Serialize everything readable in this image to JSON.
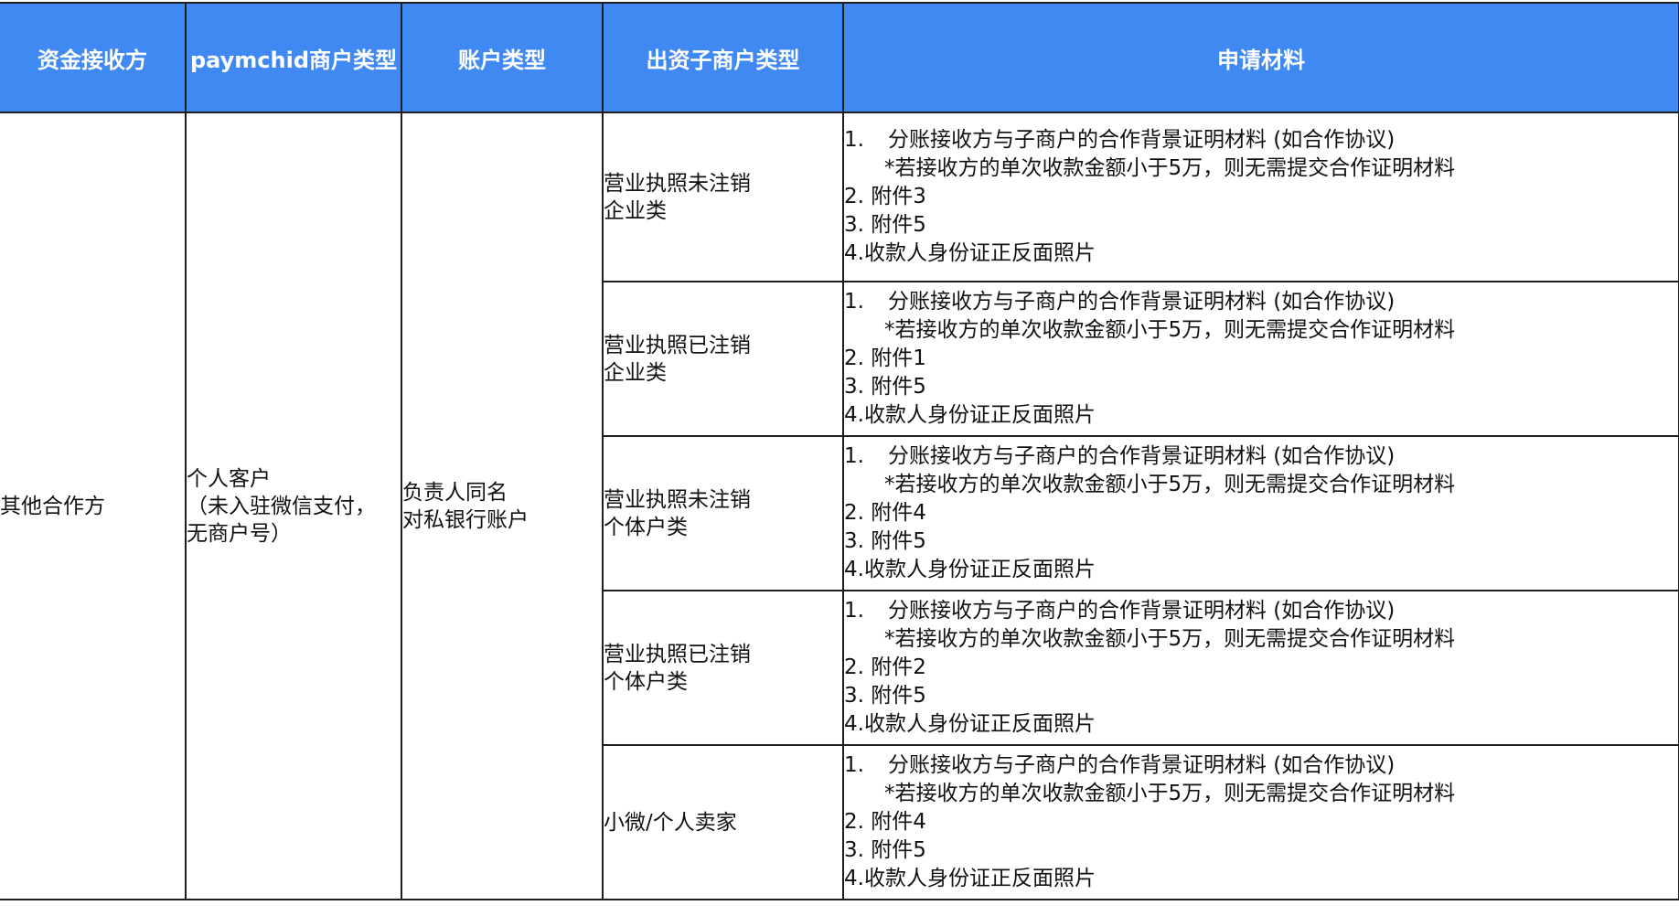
{
  "table": {
    "headers": [
      "资金接收方",
      "paymchid商户类型",
      "账户类型",
      "出资子商户类型",
      "申请材料"
    ],
    "receiver": "其他合作方",
    "merchant_type_lines": [
      "个人客户",
      "（未入驻微信支付，",
      "无商户号）"
    ],
    "account_type_lines": [
      "负责人同名",
      "对私银行账户"
    ],
    "rows": [
      {
        "sub_type_lines": [
          "营业执照未注销",
          "企业类"
        ],
        "materials": {
          "item1_num": "1.",
          "item1_text": "分账接收方与子商户的合作背景证明材料 (如合作协议)",
          "note": "*若接收方的单次收款金额小于5万，则无需提交合作证明材料",
          "item2": "2. 附件3",
          "item3": "3. 附件5",
          "item4": "4.收款人身份证正反面照片"
        }
      },
      {
        "sub_type_lines": [
          "营业执照已注销",
          "企业类"
        ],
        "materials": {
          "item1_num": "1.",
          "item1_text": "分账接收方与子商户的合作背景证明材料 (如合作协议)",
          "note": "*若接收方的单次收款金额小于5万，则无需提交合作证明材料",
          "item2": "2. 附件1",
          "item3": "3. 附件5",
          "item4": "4.收款人身份证正反面照片"
        }
      },
      {
        "sub_type_lines": [
          "营业执照未注销",
          "个体户类"
        ],
        "materials": {
          "item1_num": "1.",
          "item1_text": "分账接收方与子商户的合作背景证明材料 (如合作协议)",
          "note": "*若接收方的单次收款金额小于5万，则无需提交合作证明材料",
          "item2": "2. 附件4",
          "item3": "3. 附件5",
          "item4": "4.收款人身份证正反面照片"
        }
      },
      {
        "sub_type_lines": [
          "营业执照已注销",
          "个体户类"
        ],
        "materials": {
          "item1_num": "1.",
          "item1_text": "分账接收方与子商户的合作背景证明材料 (如合作协议)",
          "note": "*若接收方的单次收款金额小于5万，则无需提交合作证明材料",
          "item2": "2. 附件2",
          "item3": "3. 附件5",
          "item4": "4.收款人身份证正反面照片"
        }
      },
      {
        "sub_type_lines": [
          "小微/个人卖家"
        ],
        "materials": {
          "item1_num": "1.",
          "item1_text": "分账接收方与子商户的合作背景证明材料 (如合作协议)",
          "note": "*若接收方的单次收款金额小于5万，则无需提交合作证明材料",
          "item2": "2. 附件4",
          "item3": "3. 附件5",
          "item4": "4.收款人身份证正反面照片"
        }
      }
    ]
  },
  "colors": {
    "header_bg": "#4189f2",
    "header_text": "#ffffff",
    "border": "#1e1e1e"
  }
}
